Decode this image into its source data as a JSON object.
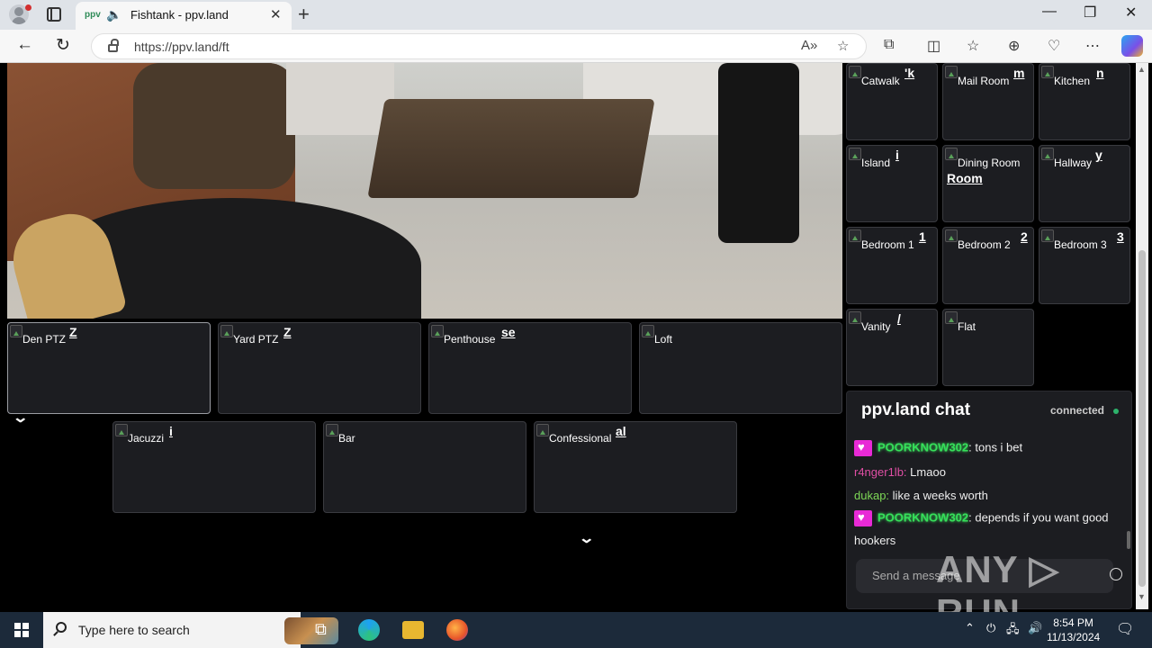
{
  "browser": {
    "tab_title": "Fishtank - ppv.land",
    "tab_favicon": "ppv-logo",
    "url": "https://ppv.land/ft"
  },
  "cameras_main": [
    {
      "label": "Den PTZ",
      "ghost": "Z"
    },
    {
      "label": "Yard PTZ",
      "ghost": "Z"
    },
    {
      "label": "Penthouse",
      "ghost": "se"
    },
    {
      "label": "Loft",
      "ghost": ""
    },
    {
      "label": "Jacuzzi",
      "ghost": "i"
    },
    {
      "label": "Bar",
      "ghost": ""
    },
    {
      "label": "Confessional",
      "ghost": "al"
    }
  ],
  "cameras_side": [
    {
      "label": "Catwalk",
      "ghost": "'k"
    },
    {
      "label": "Mail Room",
      "ghost": "m"
    },
    {
      "label": "Kitchen",
      "ghost": "n"
    },
    {
      "label": "Island",
      "ghost": "i"
    },
    {
      "label": "Dining Room",
      "ghost": "Room"
    },
    {
      "label": "Hallway",
      "ghost": "y"
    },
    {
      "label": "Bedroom 1",
      "ghost": "1"
    },
    {
      "label": "Bedroom 2",
      "ghost": "2"
    },
    {
      "label": "Bedroom 3",
      "ghost": "3"
    },
    {
      "label": "Vanity",
      "ghost": "/"
    },
    {
      "label": "Flat",
      "ghost": ""
    }
  ],
  "chat": {
    "title": "ppv.land chat",
    "status": "connected",
    "messages": [
      {
        "user": "POORKNOW302",
        "text": "tons i bet"
      },
      {
        "user": "r4nger1lb:",
        "text": "Lmaoo"
      },
      {
        "user": "dukap:",
        "text": "like a weeks worth"
      },
      {
        "user": "POORKNOW302",
        "text": "depends if you want good"
      },
      {
        "user": "",
        "text": "hookers"
      }
    ],
    "input_placeholder": "Send a message",
    "watermark": "ANY ▷ RUN"
  },
  "taskbar": {
    "search_placeholder": "Type here to search",
    "time": "8:54 PM",
    "date": "11/13/2024"
  },
  "colors": {
    "accent_green": "#36e05a",
    "badge_pink": "#e82ad6",
    "status_green": "#2db36b"
  }
}
